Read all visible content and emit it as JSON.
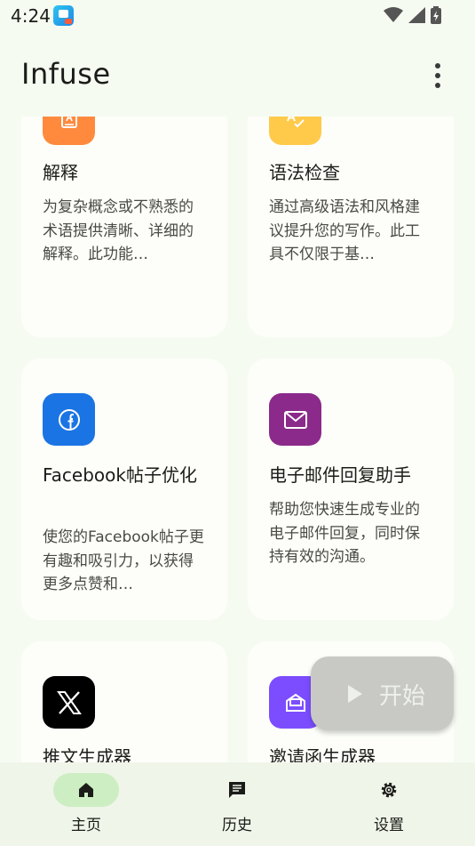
{
  "status": {
    "time": "4:24"
  },
  "app_bar": {
    "title": "Infuse"
  },
  "cards": [
    {
      "title": "解释",
      "desc": "为复杂概念或不熟悉的术语提供清晰、详细的解释。此功能…",
      "icon": "book-a-icon",
      "color": "#ff8a3d"
    },
    {
      "title": "语法检查",
      "desc": "通过高级语法和风格建议提升您的写作。此工具不仅限于基…",
      "icon": "spellcheck-icon",
      "color": "#ffca4a"
    },
    {
      "title": "Facebook帖子优化",
      "desc": "使您的Facebook帖子更有趣和吸引力，以获得更多点赞和…",
      "icon": "facebook-icon",
      "color": "#1b74e4"
    },
    {
      "title": "电子邮件回复助手",
      "desc": "帮助您快速生成专业的电子邮件回复，同时保持有效的沟通。",
      "icon": "mail-icon",
      "color": "#8b2a8a"
    },
    {
      "title": "推文生成器",
      "desc": "",
      "icon": "x-icon",
      "color": "#000000"
    },
    {
      "title": "邀请函生成器",
      "desc": "",
      "icon": "invite-icon",
      "color": "#7c4dff"
    }
  ],
  "start_button": {
    "label": "开始"
  },
  "bottom_nav": [
    {
      "label": "主页",
      "icon": "home-icon",
      "active": true
    },
    {
      "label": "历史",
      "icon": "history-icon",
      "active": false
    },
    {
      "label": "设置",
      "icon": "settings-icon",
      "active": false
    }
  ]
}
